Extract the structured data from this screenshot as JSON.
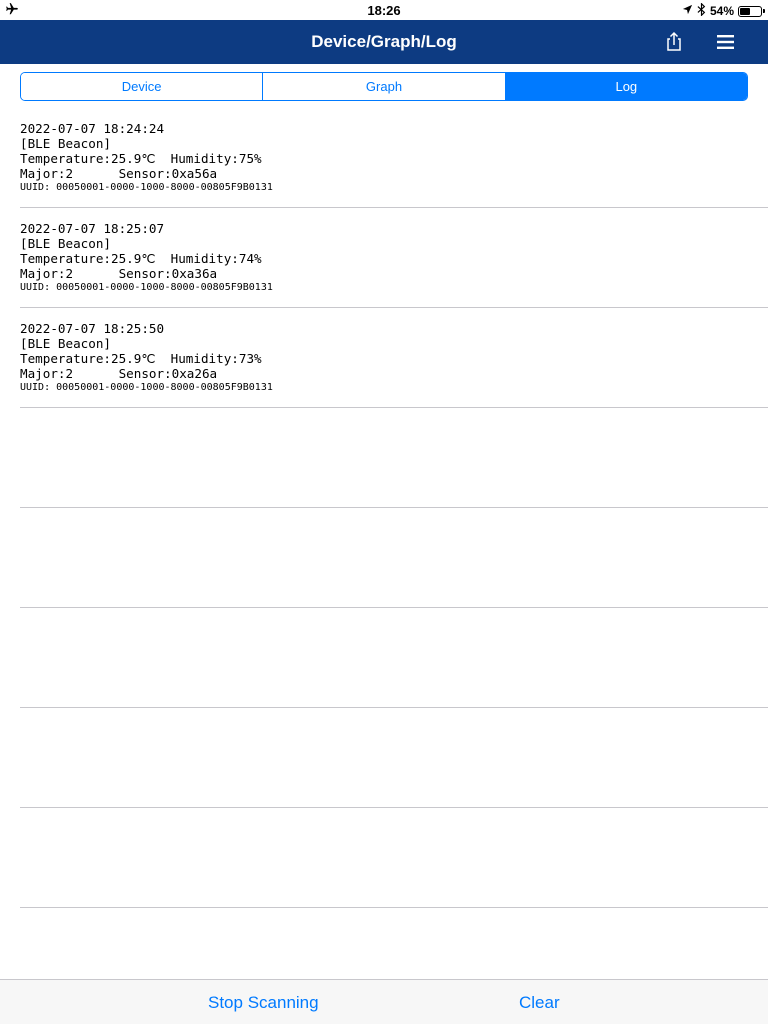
{
  "status_bar": {
    "time": "18:26",
    "battery_text": "54%",
    "battery_level": 0.54
  },
  "nav": {
    "title": "Device/Graph/Log",
    "share_icon": "share-icon",
    "menu_icon": "hamburger-menu-icon"
  },
  "segments": {
    "device": "Device",
    "graph": "Graph",
    "log": "Log",
    "selected": "Log"
  },
  "log": {
    "entries": [
      {
        "timestamp": "2022-07-07 18:24:24",
        "type": "[BLE Beacon]",
        "readings": "Temperature:25.9℃  Humidity:75%",
        "ids": "Major:2      Sensor:0xa56a",
        "uuid": "UUID: 00050001-0000-1000-8000-00805F9B0131"
      },
      {
        "timestamp": "2022-07-07 18:25:07",
        "type": "[BLE Beacon]",
        "readings": "Temperature:25.9℃  Humidity:74%",
        "ids": "Major:2      Sensor:0xa36a",
        "uuid": "UUID: 00050001-0000-1000-8000-00805F9B0131"
      },
      {
        "timestamp": "2022-07-07 18:25:50",
        "type": "[BLE Beacon]",
        "readings": "Temperature:25.9℃  Humidity:73%",
        "ids": "Major:2      Sensor:0xa26a",
        "uuid": "UUID: 00050001-0000-1000-8000-00805F9B0131"
      }
    ]
  },
  "toolbar": {
    "stop_label": "Stop Scanning",
    "clear_label": "Clear"
  },
  "colors": {
    "nav_background": "#0d3b82",
    "accent": "#007aff",
    "separator": "#c8c7cc"
  }
}
